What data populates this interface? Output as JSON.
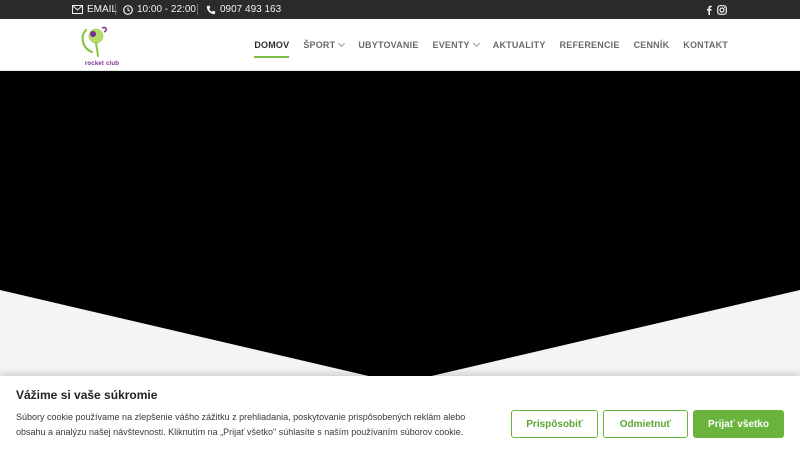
{
  "topbar": {
    "email_label": "EMAIL",
    "hours": "10:00 - 22:00",
    "phone": "0907 493 163",
    "icons": [
      "envelope-icon",
      "clock-icon",
      "phone-icon",
      "facebook-icon",
      "instagram-icon"
    ]
  },
  "logo": {
    "text": "rocket club"
  },
  "nav": {
    "items": [
      {
        "label": "DOMOV",
        "active": true,
        "dropdown": false
      },
      {
        "label": "ŠPORT",
        "active": false,
        "dropdown": true
      },
      {
        "label": "UBYTOVANIE",
        "active": false,
        "dropdown": false
      },
      {
        "label": "EVENTY",
        "active": false,
        "dropdown": true
      },
      {
        "label": "AKTUALITY",
        "active": false,
        "dropdown": false
      },
      {
        "label": "REFERENCIE",
        "active": false,
        "dropdown": false
      },
      {
        "label": "CENNÍK",
        "active": false,
        "dropdown": false
      },
      {
        "label": "KONTAKT",
        "active": false,
        "dropdown": false
      }
    ]
  },
  "cookie": {
    "title": "Vážime si vaše súkromie",
    "text_line1": "Súbory cookie používame na zlepšenie vášho zážitku z prehliadania, poskytovanie prispôsobených reklám alebo",
    "text_line2": "obsahu a analýzu našej návštevnosti. Kliknutím na „Prijať všetko\" súhlasíte s naším používaním súborov cookie.",
    "customize_label": "Prispôsobiť",
    "reject_label": "Odmietnuť",
    "accept_label": "Prijať všetko"
  },
  "colors": {
    "accent": "#6ab43e",
    "topbar_bg": "#2b2b2b",
    "hero_bg": "#000000"
  }
}
